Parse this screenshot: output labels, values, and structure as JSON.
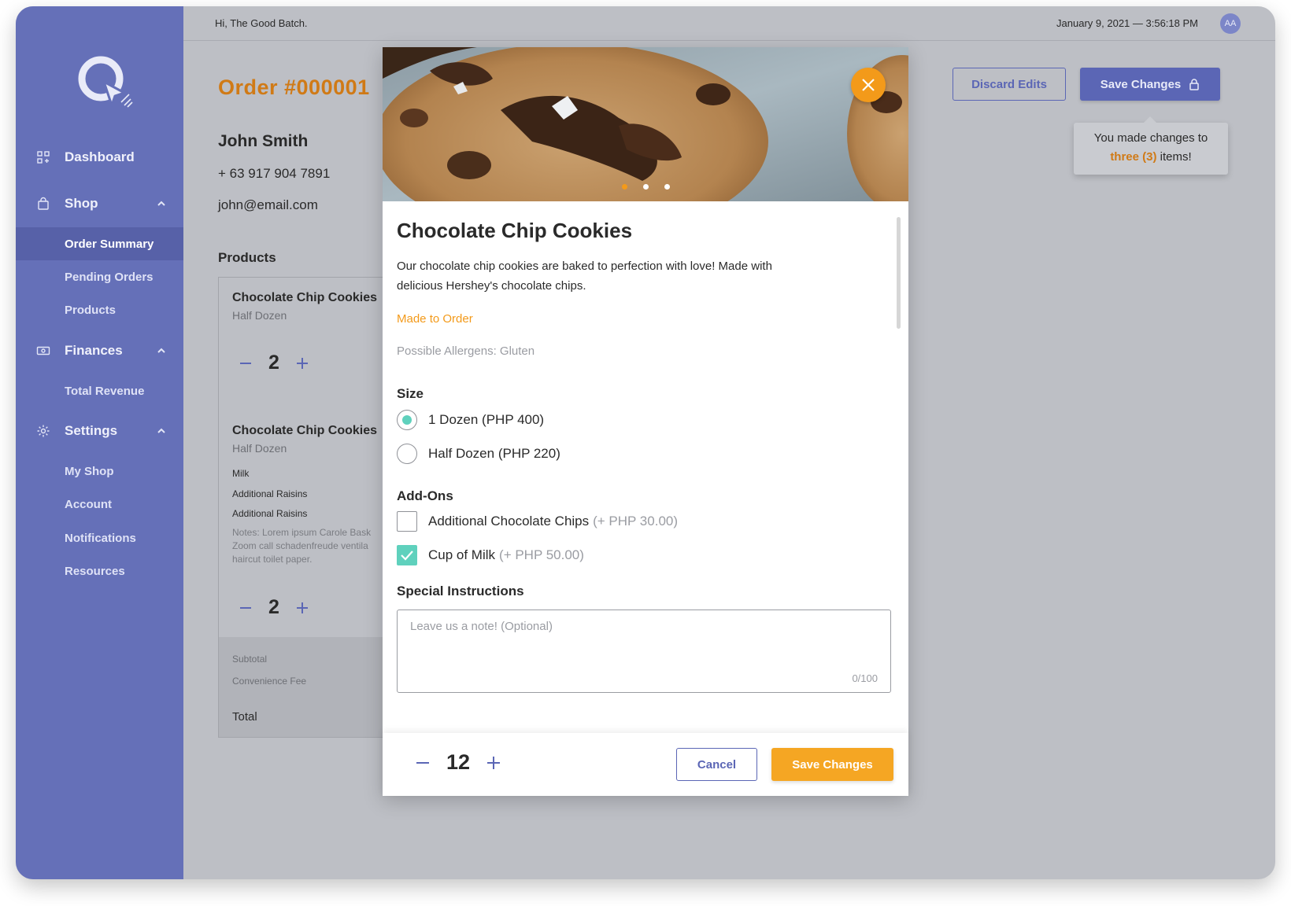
{
  "topbar": {
    "greeting": "Hi, The Good Batch.",
    "datetime": "January 9, 2021  —  3:56:18 PM",
    "avatar_initials": "AA"
  },
  "sidebar": {
    "sections": [
      {
        "label": "Dashboard",
        "icon": "dashboard-icon"
      },
      {
        "label": "Shop",
        "icon": "shopping-bag-icon",
        "expanded": true,
        "items": [
          "Order Summary",
          "Pending Orders",
          "Products"
        ],
        "active_item": "Order Summary"
      },
      {
        "label": "Finances",
        "icon": "wallet-icon",
        "expanded": true,
        "items": [
          "Total Revenue"
        ]
      },
      {
        "label": "Settings",
        "icon": "gear-icon",
        "expanded": true,
        "items": [
          "My Shop",
          "Account",
          "Notifications",
          "Resources"
        ]
      }
    ]
  },
  "order": {
    "title": "Order #000001",
    "customer_name": "John Smith",
    "phone": "+ 63 917 904 7891",
    "email": "john@email.com",
    "products_heading": "Products",
    "items": [
      {
        "name": "Chocolate Chip Cookies",
        "size": "Half Dozen",
        "qty": "2"
      },
      {
        "name": "Chocolate Chip Cookies",
        "size": "Half Dozen",
        "qty": "2",
        "addons": [
          "Milk",
          "Additional Raisins",
          "Additional Raisins"
        ],
        "notes": [
          "Notes: Lorem ipsum Carole Bask",
          "Zoom call schadenfreude ventila",
          "haircut toilet paper."
        ]
      }
    ],
    "summary": {
      "subtotal_label": "Subtotal",
      "fee_label": "Convenience Fee",
      "total_label": "Total"
    }
  },
  "actions": {
    "discard_label": "Discard Edits",
    "save_label": "Save Changes",
    "tooltip_prefix": "You made changes to",
    "tooltip_highlight": "three (3)",
    "tooltip_suffix": "items!"
  },
  "modal": {
    "carousel": {
      "slides": 3,
      "active": 0
    },
    "product_title": "Chocolate Chip Cookies",
    "description": "Our chocolate chip cookies are baked to perfection with love! Made with delicious Hershey's chocolate chips.",
    "made_to_order": "Made to Order",
    "allergens": "Possible Allergens: Gluten",
    "size_heading": "Size",
    "sizes": [
      {
        "label": "1 Dozen (PHP 400)",
        "selected": true
      },
      {
        "label": "Half Dozen (PHP 220)",
        "selected": false
      }
    ],
    "addons_heading": "Add-Ons",
    "addons": [
      {
        "label": "Additional Chocolate Chips",
        "price": "(+ PHP 30.00)",
        "checked": false
      },
      {
        "label": "Cup of Milk",
        "price": "(+ PHP 50.00)",
        "checked": true
      }
    ],
    "instructions_heading": "Special Instructions",
    "instructions_placeholder": "Leave us a note! (Optional)",
    "instructions_value": "",
    "char_counter": "0/100",
    "quantity": "12",
    "cancel_label": "Cancel",
    "save_label": "Save Changes"
  },
  "colors": {
    "sidebar": "#6570b8",
    "primary": "#5b66b5",
    "accent_orange": "#f39a1a",
    "check_teal": "#5fd1bd"
  }
}
